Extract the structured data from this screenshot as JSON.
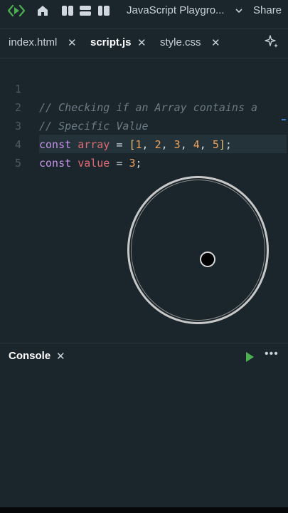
{
  "topbar": {
    "project_name": "JavaScript Playgro...",
    "share_label": "Share"
  },
  "tabs": [
    {
      "label": "index.html",
      "close": "✕"
    },
    {
      "label": "script.js",
      "close": "✕",
      "active": true
    },
    {
      "label": "style.css",
      "close": "✕"
    }
  ],
  "editor": {
    "line_numbers": [
      "1",
      "2",
      "3",
      "4",
      "5"
    ],
    "lines": {
      "l1": "// Checking if an Array contains a",
      "l2": "// Specific Value",
      "l3": {
        "kw": "const",
        "name": "array",
        "eq": "=",
        "open": "[",
        "nums": [
          "1",
          "2",
          "3",
          "4",
          "5"
        ],
        "sep": ", ",
        "close": "]",
        "semi": ";"
      },
      "l4": {
        "kw": "const",
        "name": "value",
        "eq": "=",
        "num": "3",
        "semi": ";"
      }
    }
  },
  "console": {
    "label": "Console",
    "close": "✕",
    "more": "•••"
  },
  "colors": {
    "background": "#1b262c",
    "keyword": "#c791ea",
    "variable": "#e06c75",
    "number": "#f0a35e",
    "comment": "#6b7a84",
    "run_green": "#4caf50"
  }
}
